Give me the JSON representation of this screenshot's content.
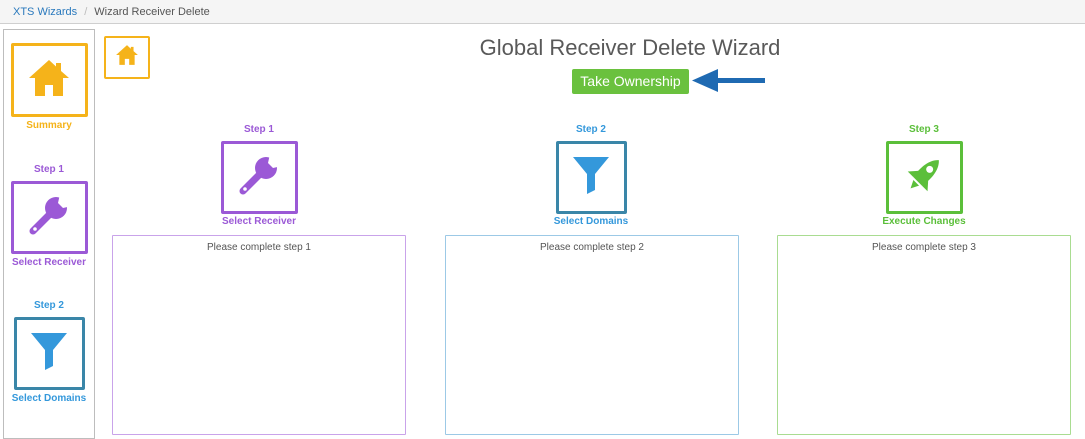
{
  "breadcrumb": {
    "root": "XTS Wizards",
    "separator": "/",
    "current": "Wizard Receiver Delete"
  },
  "sidebar": {
    "items": [
      {
        "step": "",
        "label": "Summary",
        "icon": "home-icon",
        "color": "#f5b31a"
      },
      {
        "step": "Step 1",
        "label": "Select Receiver",
        "icon": "wrench-icon",
        "color": "#9b59d6"
      },
      {
        "step": "Step 2",
        "label": "Select Domains",
        "icon": "filter-icon",
        "color": "#3a86a8"
      }
    ]
  },
  "header": {
    "title": "Global Receiver Delete Wizard",
    "ownership_button": "Take Ownership",
    "home_icon": "home-icon"
  },
  "steps": [
    {
      "step": "Step 1",
      "label": "Select Receiver",
      "icon": "wrench-icon",
      "color": "#9b59d6",
      "message": "Please complete step 1"
    },
    {
      "step": "Step 2",
      "label": "Select Domains",
      "icon": "filter-icon",
      "color": "#3a86a8",
      "message": "Please complete step 2"
    },
    {
      "step": "Step 3",
      "label": "Execute Changes",
      "icon": "rocket-icon",
      "color": "#5bbf3a",
      "message": "Please complete step 3"
    }
  ],
  "colors": {
    "accent_orange": "#f5b31a",
    "accent_purple": "#9b59d6",
    "accent_teal": "#3a86a8",
    "accent_blue": "#3498db",
    "accent_green": "#5bbf3a",
    "link_blue": "#2a79bd",
    "arrow_blue": "#1f6ab2"
  }
}
